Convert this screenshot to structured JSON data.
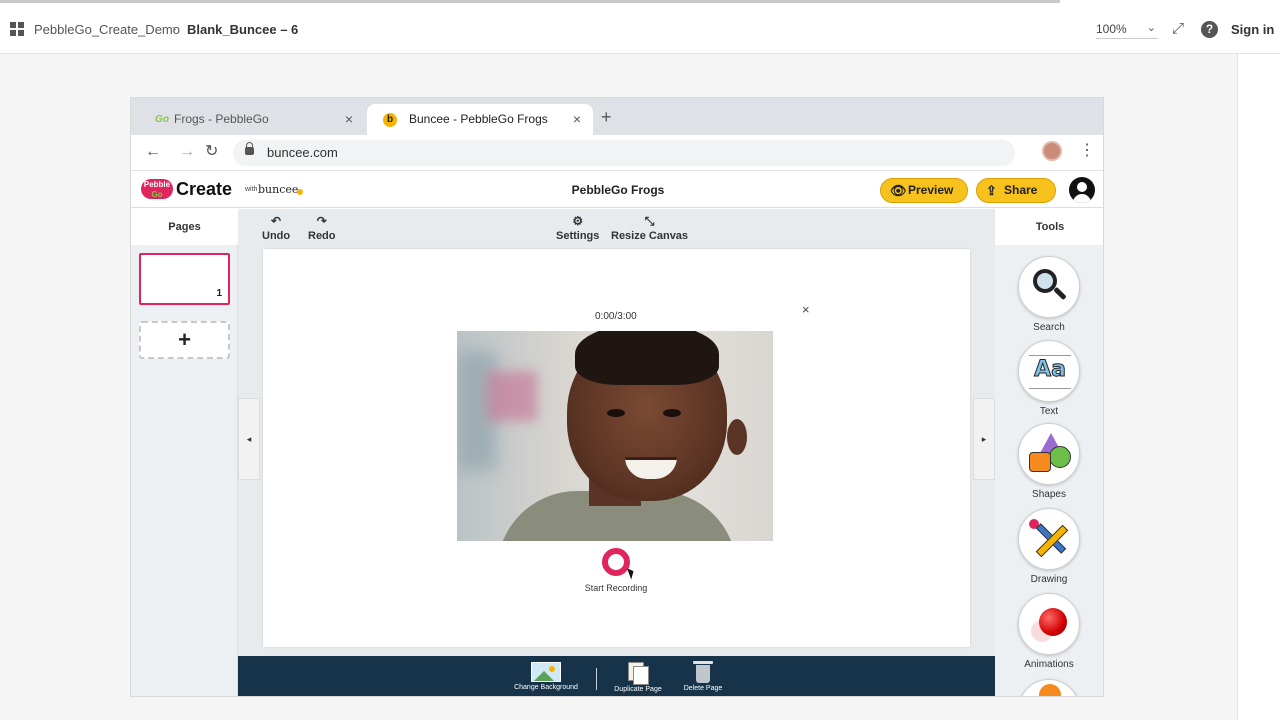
{
  "topbar": {
    "breadcrumb_parent": "PebbleGo_Create_Demo",
    "breadcrumb_sep": "›",
    "breadcrumb_current": "Blank_Buncee – 6",
    "zoom": "100%",
    "sign_in": "Sign in",
    "help_glyph": "?"
  },
  "browser": {
    "tabs": [
      {
        "favicon_text": "Go",
        "title": "Frogs - PebbleGo",
        "close": "×"
      },
      {
        "favicon_text": "b",
        "title": "Buncee - PebbleGo Frogs",
        "close": "×"
      }
    ],
    "new_tab": "+",
    "url": "buncee.com"
  },
  "app": {
    "logo": {
      "pebble": "Pebble",
      "go": "Go",
      "create": "Create",
      "with": "with",
      "buncee": "buncee"
    },
    "project_title": "PebbleGo Frogs",
    "preview_label": "Preview",
    "share_label": "Share"
  },
  "pages_panel": {
    "header": "Pages",
    "pages": [
      {
        "number": "1"
      }
    ],
    "add_glyph": "+"
  },
  "toolbar": {
    "undo": "Undo",
    "redo": "Redo",
    "settings": "Settings",
    "resize": "Resize Canvas"
  },
  "recorder": {
    "timer": "0:00/3:00",
    "close": "×",
    "start_label": "Start Recording"
  },
  "bottombar": {
    "change_background": "Change Background",
    "duplicate_page": "Duplicate Page",
    "delete_page": "Delete Page"
  },
  "tools_panel": {
    "header": "Tools",
    "items": [
      {
        "label": "Search",
        "icon": "magnifier-icon"
      },
      {
        "label": "Text",
        "icon": "text-aa-icon",
        "glyph": "Aa"
      },
      {
        "label": "Shapes",
        "icon": "shapes-icon"
      },
      {
        "label": "Drawing",
        "icon": "drawing-icon"
      },
      {
        "label": "Animations",
        "icon": "animations-icon"
      }
    ]
  },
  "colors": {
    "accent_pink": "#e0245e",
    "button_yellow": "#f8c21c",
    "bottom_bar": "#163349"
  }
}
